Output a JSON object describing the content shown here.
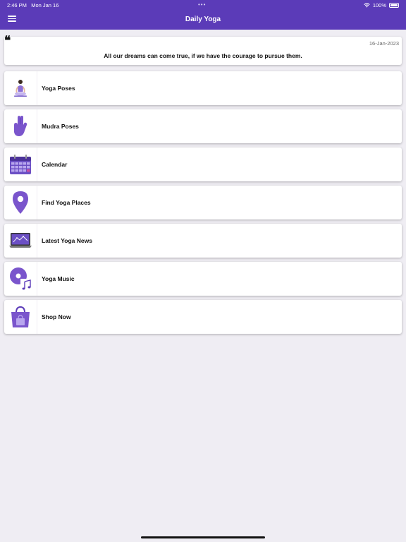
{
  "status_bar": {
    "time": "2:46 PM",
    "date": "Mon Jan 16",
    "battery": "100%"
  },
  "nav": {
    "title": "Daily Yoga",
    "menu_icon": "hamburger-icon"
  },
  "quote": {
    "date": "16-Jan-2023",
    "text": "All our dreams can come true, if we have the courage to pursue them."
  },
  "menu": {
    "items": [
      {
        "label": "Yoga Poses",
        "icon": "yoga-pose-icon"
      },
      {
        "label": "Mudra Poses",
        "icon": "mudra-hand-icon"
      },
      {
        "label": "Calendar",
        "icon": "calendar-icon"
      },
      {
        "label": "Find Yoga Places",
        "icon": "map-pin-icon"
      },
      {
        "label": "Latest Yoga News",
        "icon": "laptop-news-icon"
      },
      {
        "label": "Yoga Music",
        "icon": "music-disc-icon"
      },
      {
        "label": "Shop Now",
        "icon": "shopping-bag-icon"
      }
    ]
  },
  "colors": {
    "accent": "#5b3bb8",
    "icon_purple": "#7a55cc",
    "background": "#efedf3"
  }
}
